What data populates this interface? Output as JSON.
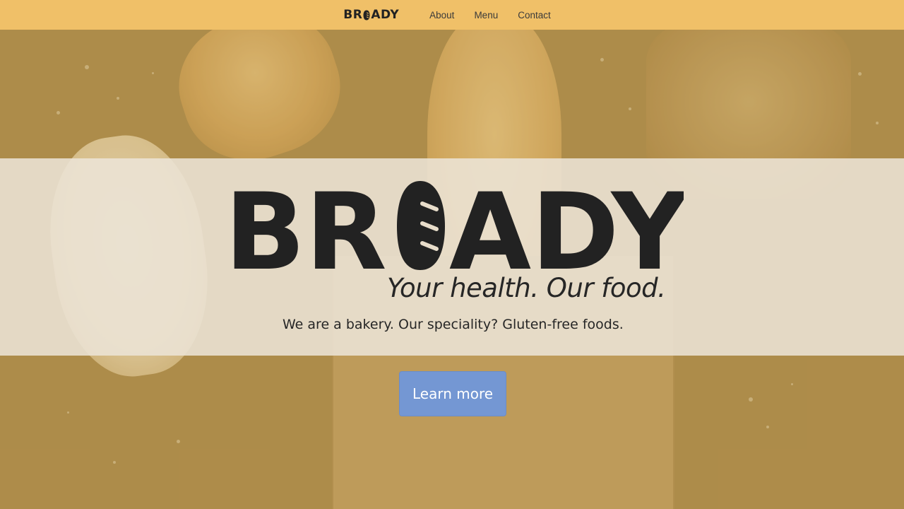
{
  "nav": {
    "logo_left": "BR",
    "logo_right": "ADY",
    "links": [
      "About",
      "Menu",
      "Contact"
    ]
  },
  "hero": {
    "logo_left": "BR",
    "logo_right": "ADY",
    "tagline": "Your health. Our food.",
    "description": "We are a bakery. Our speciality? Gluten-free foods.",
    "cta_label": "Learn more"
  },
  "colors": {
    "navbar": "#f0c068",
    "overlay": "#ae8c4a",
    "band": "#ece4d6",
    "button": "#7497d3",
    "text": "#222222"
  }
}
